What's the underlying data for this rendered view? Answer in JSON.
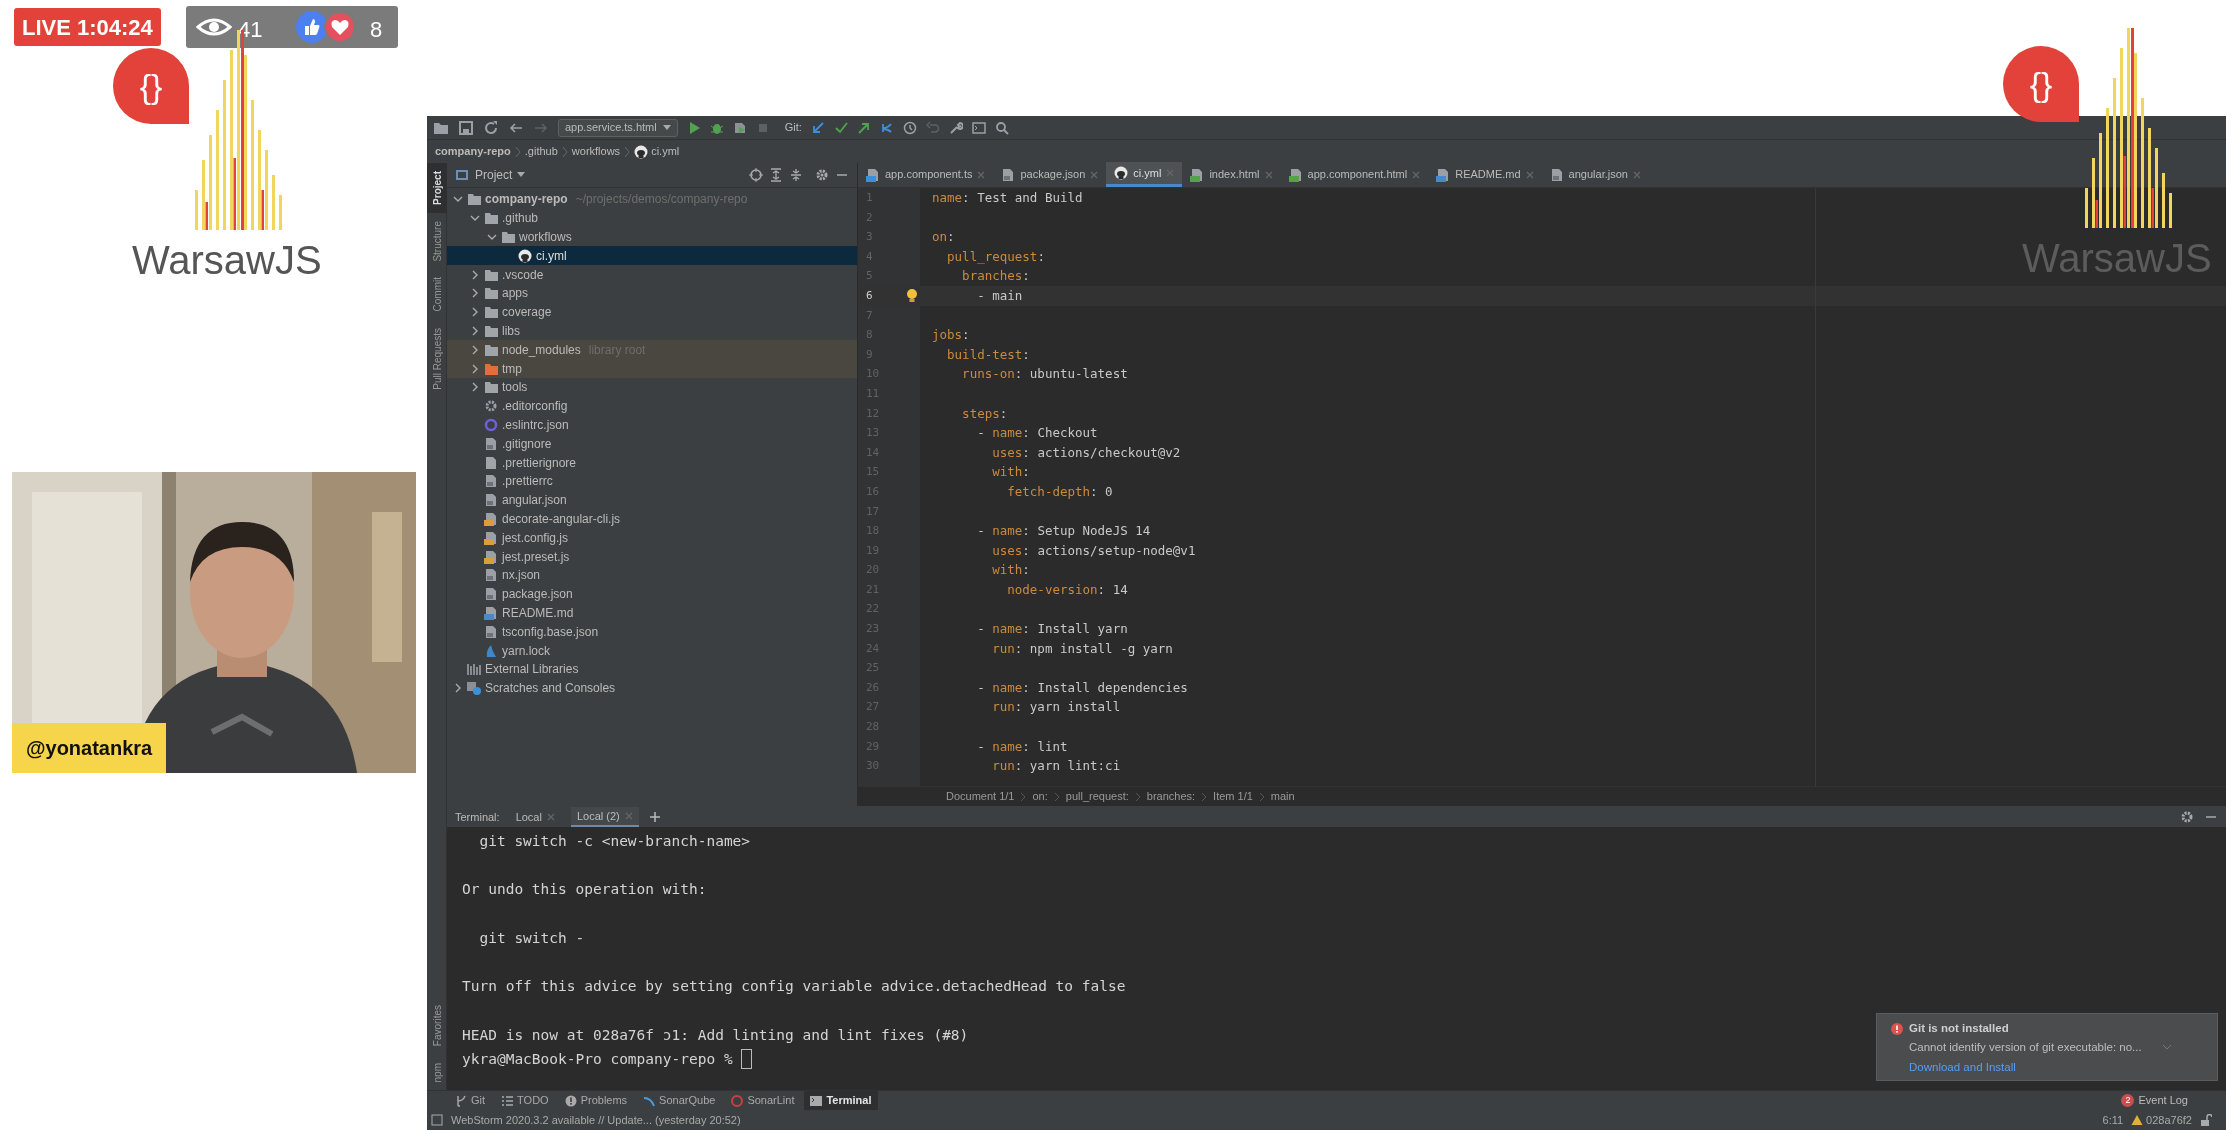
{
  "stream": {
    "live_label": "LIVE 1:04:24",
    "viewers": "41",
    "reactions": "8",
    "presenter": "@yonatankra"
  },
  "logos": [
    {
      "mark": "{}",
      "text": "WarsawJS"
    },
    {
      "mark": "{}",
      "text": "WarsawJS"
    }
  ],
  "ide": {
    "toolbar": {
      "run_config": "app.service.ts.html",
      "git_label": "Git:"
    },
    "breadcrumb": [
      {
        "label": "company-repo",
        "kind": "project"
      },
      {
        "label": ".github",
        "kind": "folder"
      },
      {
        "label": "workflows",
        "kind": "folder"
      },
      {
        "label": "ci.yml",
        "kind": "github"
      }
    ],
    "side_tabs": [
      {
        "label": "Project",
        "selected": true
      },
      {
        "label": "Structure",
        "selected": false
      },
      {
        "label": "Commit",
        "selected": false
      },
      {
        "label": "Pull Requests",
        "selected": false
      }
    ],
    "side_tabs_bottom": [
      {
        "label": "Favorites",
        "selected": false
      },
      {
        "label": "npm",
        "selected": false
      }
    ],
    "project_panel": {
      "title": "Project",
      "tree": [
        {
          "label": "company-repo",
          "note": "~/projects/demos/company-repo",
          "kind": "folder",
          "expanded": true,
          "selected": false,
          "children": [
            {
              "label": ".github",
              "kind": "folder",
              "expanded": true,
              "selected": false,
              "children": [
                {
                  "label": "workflows",
                  "kind": "folder",
                  "expanded": true,
                  "selected": false,
                  "children": [
                    {
                      "label": "ci.yml",
                      "kind": "github",
                      "selected": true
                    }
                  ]
                }
              ]
            },
            {
              "label": ".vscode",
              "kind": "folder",
              "expanded": false,
              "selected": false
            },
            {
              "label": "apps",
              "kind": "folder",
              "expanded": false,
              "selected": false
            },
            {
              "label": "coverage",
              "kind": "folder",
              "expanded": false,
              "selected": false
            },
            {
              "label": "libs",
              "kind": "folder",
              "expanded": false,
              "selected": false
            },
            {
              "label": "node_modules",
              "note": "library root",
              "kind": "library",
              "expanded": false,
              "selected": false
            },
            {
              "label": "tmp",
              "kind": "excluded",
              "expanded": false,
              "selected": false
            },
            {
              "label": "tools",
              "kind": "folder",
              "expanded": false,
              "selected": false
            },
            {
              "label": ".editorconfig",
              "kind": "config",
              "selected": false
            },
            {
              "label": ".eslintrc.json",
              "kind": "eslint",
              "selected": false
            },
            {
              "label": ".gitignore",
              "kind": "file",
              "selected": false
            },
            {
              "label": ".prettierignore",
              "kind": "text",
              "selected": false
            },
            {
              "label": ".prettierrc",
              "kind": "file",
              "selected": false
            },
            {
              "label": "angular.json",
              "kind": "file",
              "selected": false
            },
            {
              "label": "decorate-angular-cli.js",
              "kind": "js",
              "selected": false
            },
            {
              "label": "jest.config.js",
              "kind": "js",
              "selected": false
            },
            {
              "label": "jest.preset.js",
              "kind": "js",
              "selected": false
            },
            {
              "label": "nx.json",
              "kind": "file",
              "selected": false
            },
            {
              "label": "package.json",
              "kind": "file",
              "selected": false
            },
            {
              "label": "README.md",
              "kind": "md",
              "selected": false
            },
            {
              "label": "tsconfig.base.json",
              "kind": "file",
              "selected": false
            },
            {
              "label": "yarn.lock",
              "kind": "yarn",
              "selected": false
            }
          ]
        },
        {
          "label": "External Libraries",
          "kind": "libraries",
          "selected": false
        },
        {
          "label": "Scratches and Consoles",
          "kind": "scratches",
          "expanded": false,
          "selected": false
        }
      ]
    },
    "editor_tabs": [
      {
        "label": "app.component.ts",
        "kind": "ts",
        "selected": false
      },
      {
        "label": "package.json",
        "kind": "file",
        "selected": false
      },
      {
        "label": "ci.yml",
        "kind": "github",
        "selected": true
      },
      {
        "label": "index.html",
        "kind": "html",
        "selected": false
      },
      {
        "label": "app.component.html",
        "kind": "html",
        "selected": false
      },
      {
        "label": "README.md",
        "kind": "md",
        "selected": false
      },
      {
        "label": "angular.json",
        "kind": "file",
        "selected": false
      }
    ],
    "code_lines": [
      {
        "number": "1",
        "text": "name: Test and Build",
        "current": false
      },
      {
        "number": "2",
        "current": false
      },
      {
        "number": "3",
        "text": "on:",
        "current": false
      },
      {
        "number": "4",
        "text": "  pull_request:",
        "current": false
      },
      {
        "number": "5",
        "text": "    branches:",
        "current": false
      },
      {
        "number": "6",
        "text": "      - main",
        "current": true
      },
      {
        "number": "7",
        "current": false
      },
      {
        "number": "8",
        "text": "jobs:",
        "current": false
      },
      {
        "number": "9",
        "text": "  build-test:",
        "current": false
      },
      {
        "number": "10",
        "text": "    runs-on: ubuntu-latest",
        "current": false
      },
      {
        "number": "11",
        "current": false
      },
      {
        "number": "12",
        "text": "    steps:",
        "current": false
      },
      {
        "number": "13",
        "text": "      - name: Checkout",
        "current": false
      },
      {
        "number": "14",
        "text": "        uses: actions/checkout@v2",
        "current": false
      },
      {
        "number": "15",
        "text": "        with:",
        "current": false
      },
      {
        "number": "16",
        "text": "          fetch-depth: 0",
        "current": false
      },
      {
        "number": "17",
        "current": false
      },
      {
        "number": "18",
        "text": "      - name: Setup NodeJS 14",
        "current": false
      },
      {
        "number": "19",
        "text": "        uses: actions/setup-node@v1",
        "current": false
      },
      {
        "number": "20",
        "text": "        with:",
        "current": false
      },
      {
        "number": "21",
        "text": "          node-version: 14",
        "current": false
      },
      {
        "number": "22",
        "current": false
      },
      {
        "number": "23",
        "text": "      - name: Install yarn",
        "current": false
      },
      {
        "number": "24",
        "text": "        run: npm install -g yarn",
        "current": false
      },
      {
        "number": "25",
        "current": false
      },
      {
        "number": "26",
        "text": "      - name: Install dependencies",
        "current": false
      },
      {
        "number": "27",
        "text": "        run: yarn install",
        "current": false
      },
      {
        "number": "28",
        "current": false
      },
      {
        "number": "29",
        "text": "      - name: lint",
        "current": false
      },
      {
        "number": "30",
        "text": "        run: yarn lint:ci",
        "current": false
      }
    ],
    "editor_breadcrumb": [
      "Document 1/1",
      "on:",
      "pull_request:",
      "branches:",
      "Item 1/1",
      "main"
    ],
    "terminal": {
      "label": "Terminal:",
      "tabs": [
        {
          "label": "Local",
          "selected": false
        },
        {
          "label": "Local (2)",
          "selected": true
        }
      ],
      "lines": [
        {
          "kind": "output",
          "text": "  git switch -c <new-branch-name>"
        },
        {
          "kind": "blank"
        },
        {
          "kind": "output",
          "text": "Or undo this operation with:"
        },
        {
          "kind": "blank"
        },
        {
          "kind": "output",
          "text": "  git switch -"
        },
        {
          "kind": "blank"
        },
        {
          "kind": "output",
          "text": "Turn off this advice by setting config variable advice.detachedHead to false"
        },
        {
          "kind": "blank"
        },
        {
          "kind": "output",
          "text": "HEAD is now at 028a76f ɔ1: Add linting and lint fixes (#8)"
        }
      ],
      "prompt": "ykra@MacBook-Pro company-repo %"
    },
    "tool_windows": [
      {
        "label": "Git",
        "kind": "git",
        "selected": false
      },
      {
        "label": "TODO",
        "kind": "todo",
        "selected": false
      },
      {
        "label": "Problems",
        "kind": "problems",
        "selected": false
      },
      {
        "label": "SonarQube",
        "kind": "sonarqube",
        "selected": false
      },
      {
        "label": "SonarLint",
        "kind": "sonarlint",
        "selected": false
      },
      {
        "label": "Terminal",
        "kind": "terminal",
        "selected": true
      }
    ],
    "event_log": {
      "label": "Event Log",
      "count": "2"
    },
    "status": {
      "message": "WebStorm 2020.3.2 available // Update... (yesterday 20:52)",
      "position": "6:11",
      "branch": "028a76f2"
    },
    "notification": {
      "title": "Git is not installed",
      "message": "Cannot identify version of git executable: no...",
      "link": "Download and Install"
    }
  }
}
